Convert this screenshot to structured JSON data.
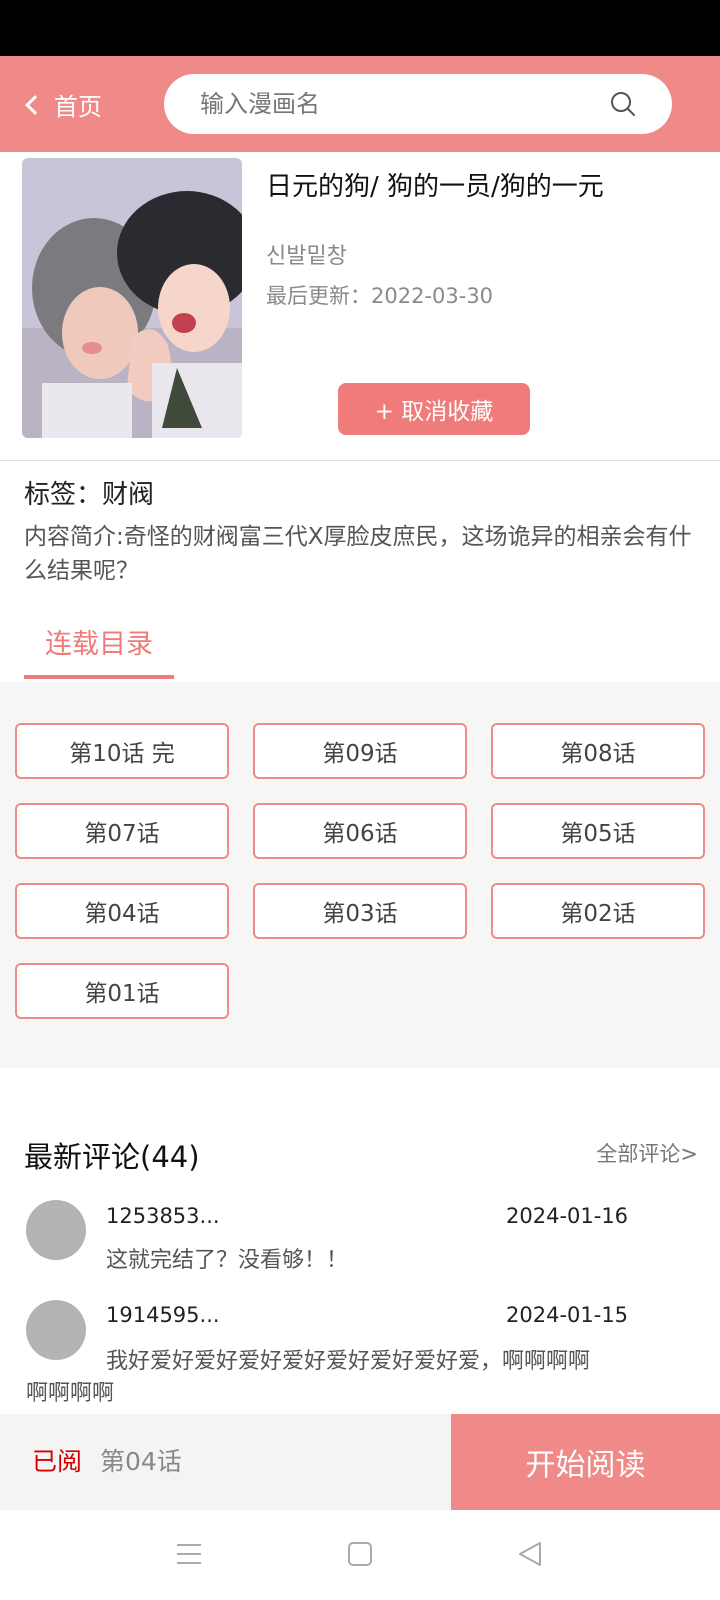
{
  "header": {
    "back_label": "首页",
    "search_placeholder": "输入漫画名"
  },
  "comic": {
    "title": "日元的狗/ 狗的一员/狗的一元",
    "author": "신발밑창",
    "updated_label": "最后更新：",
    "updated_date": "2022-03-30",
    "fav_button": "+ 取消收藏",
    "tags_label": "标签：",
    "tags_value": "财阀",
    "intro": "内容简介:奇怪的财阀富三代X厚脸皮庶民，这场诡异的相亲会有什么结果呢？"
  },
  "catalog": {
    "tab_label": "连载目录",
    "chapters": [
      "第10话 完",
      "第09话",
      "第08话",
      "第07话",
      "第06话",
      "第05话",
      "第04话",
      "第03话",
      "第02话",
      "第01话"
    ]
  },
  "comments": {
    "title": "最新评论(44)",
    "all_link": "全部评论>",
    "items": [
      {
        "user": "1253853...",
        "date": "2024-01-16",
        "text_line1": "这就完结了？没看够！！",
        "text_line2": ""
      },
      {
        "user": "1914595...",
        "date": "2024-01-15",
        "text_line1": "我好爱好爱好爱好爱好爱好爱好爱好爱，啊啊啊啊",
        "text_line2": "啊啊啊啊"
      }
    ]
  },
  "bottom": {
    "read_label": "已阅",
    "read_chapter": "第04话",
    "start_button": "开始阅读"
  },
  "colors": {
    "accent": "#ef8a88",
    "button": "#ef7c7b",
    "read_red": "#d70000"
  },
  "icons": {
    "search": "search-icon",
    "back": "chevron-left-icon",
    "nav": [
      "menu-icon",
      "home-square-icon",
      "back-triangle-icon"
    ]
  }
}
